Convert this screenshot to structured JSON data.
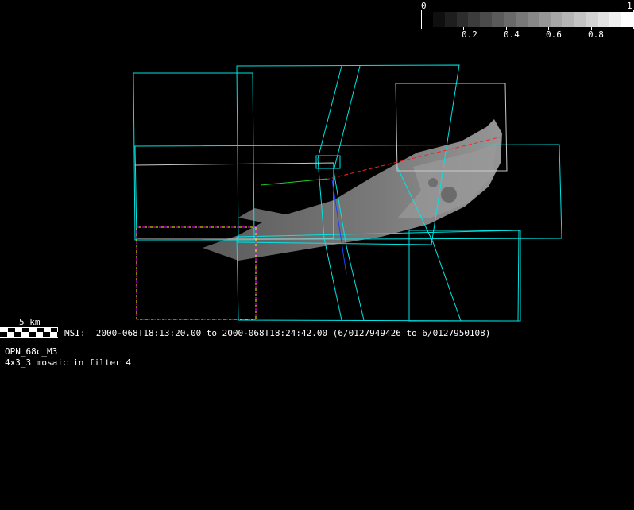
{
  "colorbar": {
    "min_label": "0",
    "max_label": "1",
    "tick_labels": [
      "0.2",
      "0.4",
      "0.6",
      "0.8"
    ],
    "steps": 17
  },
  "scale_bar": {
    "label": "5 km"
  },
  "info": {
    "time_range": "MSI:  2000-068T18:13:20.00 to 2000-068T18:24:42.00 (6/0127949426 to 6/0127950108)",
    "observation": "OPN_68c_M3",
    "description": "4x3_3 mosaic in filter 4"
  },
  "colors": {
    "footprint": "#00e5e5",
    "outline": "#c8c8c8",
    "selection": "#ff00ff",
    "selection_dash": "#ffff00",
    "axis_x": "#ff2020",
    "axis_y": "#20d020",
    "axis_z": "#2040ff"
  }
}
